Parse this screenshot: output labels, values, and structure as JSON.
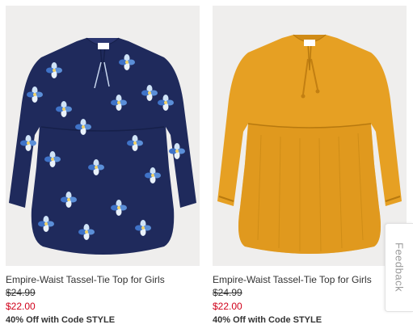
{
  "products": [
    {
      "image_label": "navy floral tassel-tie top",
      "title": "Empire-Waist Tassel-Tie Top for Girls",
      "original_price": "$24.99",
      "sale_price": "$22.00",
      "promo": "40% Off with Code STYLE",
      "garment_color": "#1f2a5c"
    },
    {
      "image_label": "mustard tassel-tie top",
      "title": "Empire-Waist Tassel-Tie Top for Girls",
      "original_price": "$24.99",
      "sale_price": "$22.00",
      "promo": "40% Off with Code STYLE",
      "garment_color": "#e6a023"
    }
  ],
  "feedback_tab": {
    "label": "Feedback"
  },
  "colors": {
    "sale_price": "#d0021b",
    "image_background": "#efeeed"
  }
}
